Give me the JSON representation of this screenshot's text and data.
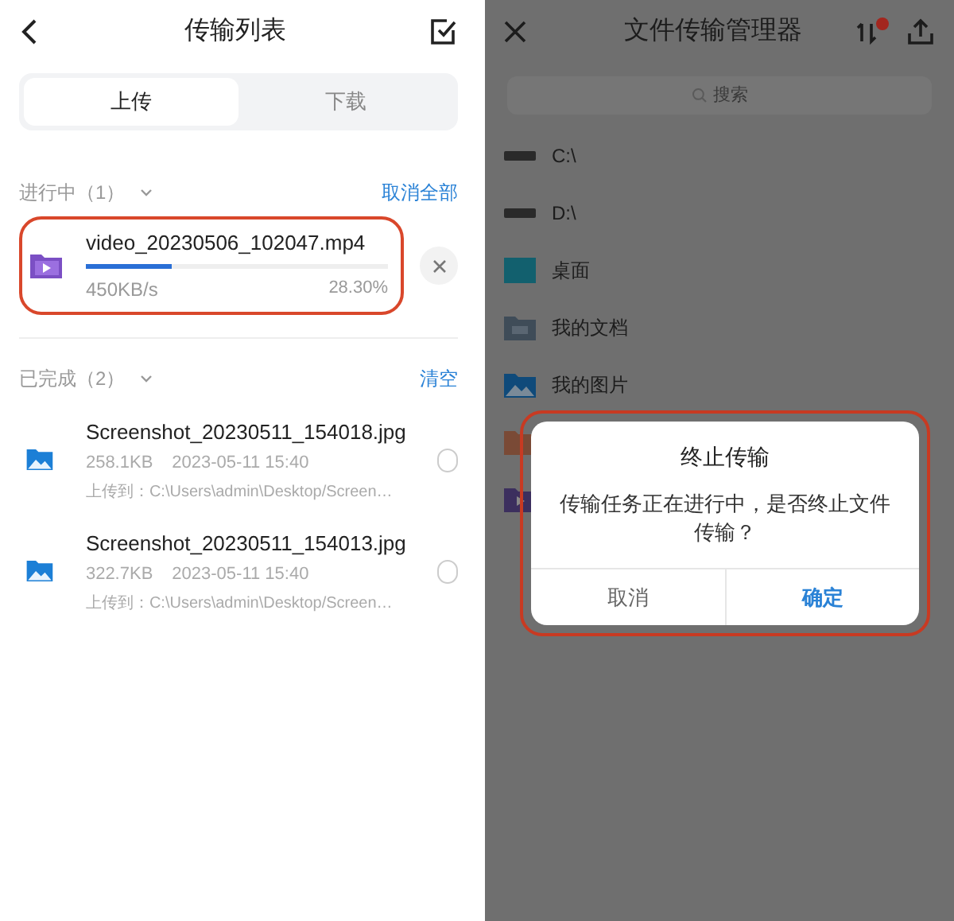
{
  "left": {
    "title": "传输列表",
    "tabs": [
      {
        "label": "上传",
        "selected": true
      },
      {
        "label": "下载",
        "selected": false
      }
    ],
    "in_progress": {
      "heading": "进行中（1）",
      "expanded": true,
      "action": "取消全部",
      "items": [
        {
          "name": "video_20230506_102047.mp4",
          "speed": "450KB/s",
          "percent": "28.30%",
          "level": 0.283,
          "highlighted": true
        }
      ]
    },
    "completed": {
      "heading": "已完成（2）",
      "expanded": true,
      "action": "清空",
      "items": [
        {
          "name": "Screenshot_20230511_154018.jpg",
          "size": "258.1KB",
          "date": "2023-05-11 15:40",
          "path": "上传到：C:\\Users\\admin\\Desktop/Screen…",
          "checked": false
        },
        {
          "name": "Screenshot_20230511_154013.jpg",
          "size": "322.7KB",
          "date": "2023-05-11 15:40",
          "path": "上传到：C:\\Users\\admin\\Desktop/Screen…",
          "checked": false
        }
      ]
    }
  },
  "right": {
    "title": "文件传输管理器",
    "search": {
      "placeholder": "搜索"
    },
    "folders": [
      {
        "kind": "drive",
        "name": "C:\\"
      },
      {
        "kind": "drive",
        "name": "D:\\"
      },
      {
        "kind": "desktop",
        "name": "桌面"
      },
      {
        "kind": "documents",
        "name": "我的文档"
      },
      {
        "kind": "pictures",
        "name": "我的图片"
      },
      {
        "kind": "orange"
      },
      {
        "kind": "video"
      }
    ],
    "dialog": {
      "title": "终止传输",
      "message": "传输任务正在进行中，是否终止文件传输？",
      "highlighted": true,
      "buttons": [
        {
          "label": "取消",
          "kind": "cancel"
        },
        {
          "label": "确定",
          "kind": "confirm"
        }
      ]
    }
  }
}
